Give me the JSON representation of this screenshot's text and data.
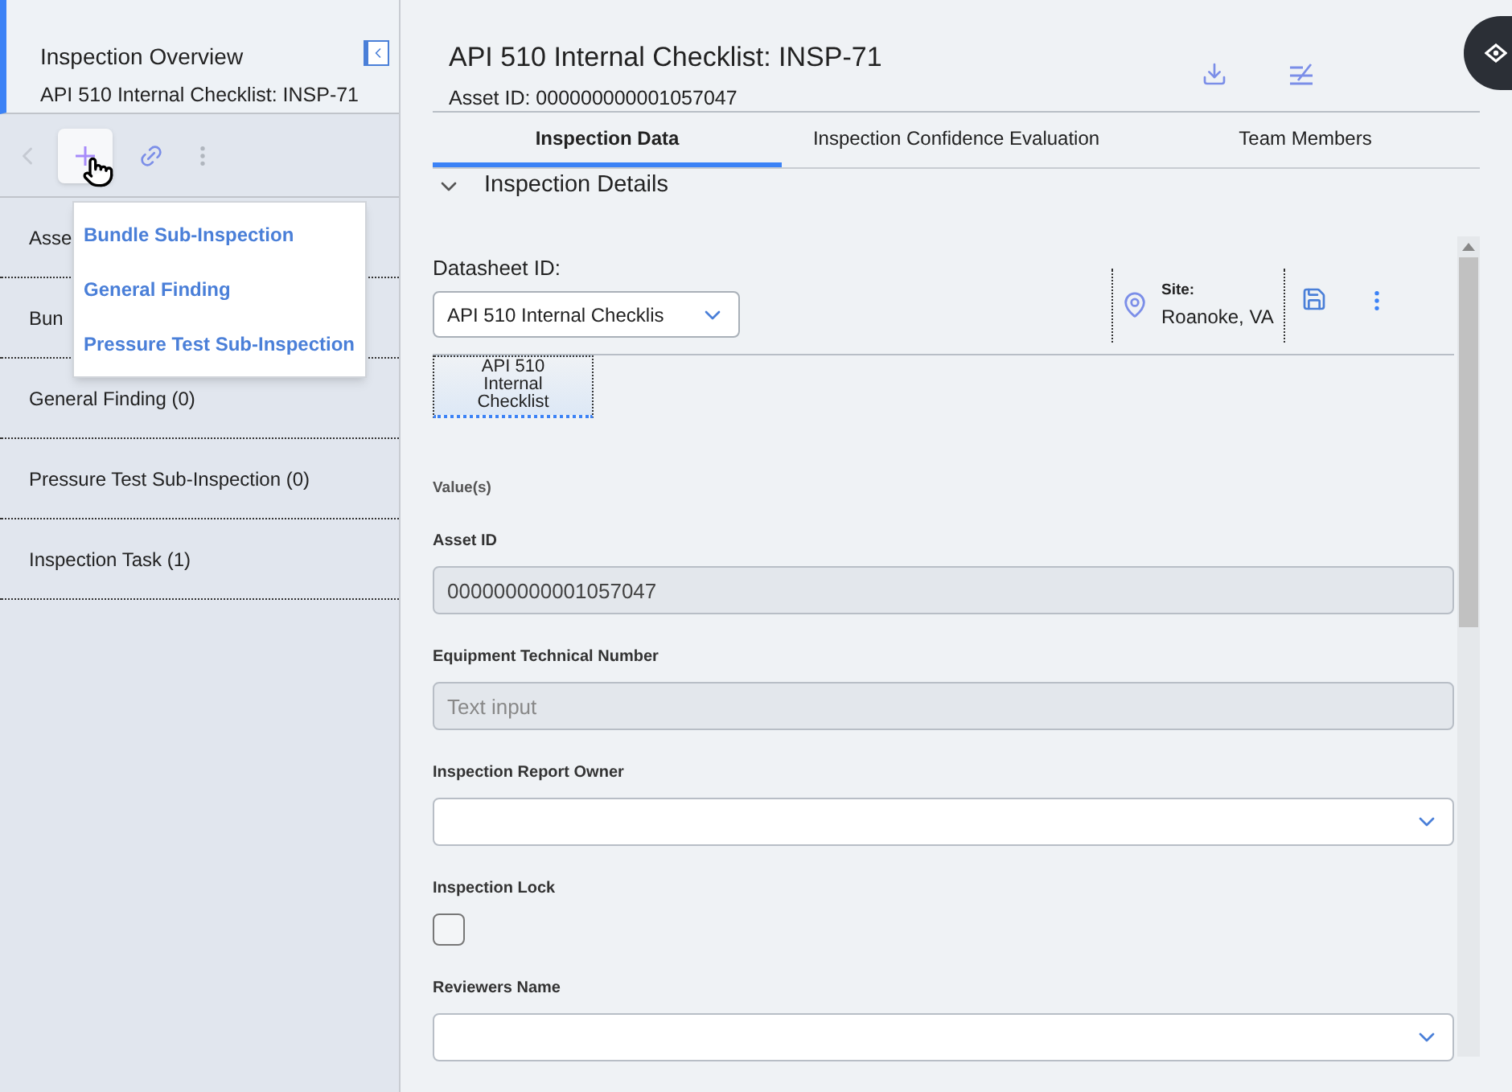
{
  "sidebar": {
    "title": "Inspection Overview",
    "subtitle": "API 510 Internal Checklist: INSP-71",
    "items": [
      {
        "label": "Asse"
      },
      {
        "label": "Bun"
      },
      {
        "label": "General Finding (0)"
      },
      {
        "label": "Pressure Test Sub-Inspection (0)"
      },
      {
        "label": "Inspection Task (1)"
      }
    ],
    "add_menu": [
      "Bundle Sub-Inspection",
      "General Finding",
      "Pressure Test Sub-Inspection"
    ]
  },
  "header": {
    "title": "API 510 Internal Checklist: INSP-71",
    "subtitle": "Asset ID: 000000000001057047"
  },
  "tabs": [
    {
      "label": "Inspection Data",
      "selected": true
    },
    {
      "label": "Inspection Confidence Evaluation",
      "selected": false
    },
    {
      "label": "Team Members",
      "selected": false
    }
  ],
  "section": {
    "title": "Inspection Details",
    "expanded": true
  },
  "datasheet": {
    "label": "Datasheet ID:",
    "value": "API 510 Internal Checklis",
    "site_label": "Site:",
    "site": "Roanoke, VA",
    "tab": "API 510 Internal Checklist",
    "group": "Value(s)"
  },
  "fields": [
    {
      "kind": "text",
      "label": "Asset ID",
      "value": "000000000001057047"
    },
    {
      "kind": "text",
      "label": "Equipment Technical Number",
      "placeholder": "Text input"
    },
    {
      "kind": "select",
      "label": "Inspection Report Owner"
    },
    {
      "kind": "checkbox",
      "label": "Inspection Lock",
      "checked": false
    },
    {
      "kind": "select",
      "label": "Reviewers Name"
    }
  ]
}
